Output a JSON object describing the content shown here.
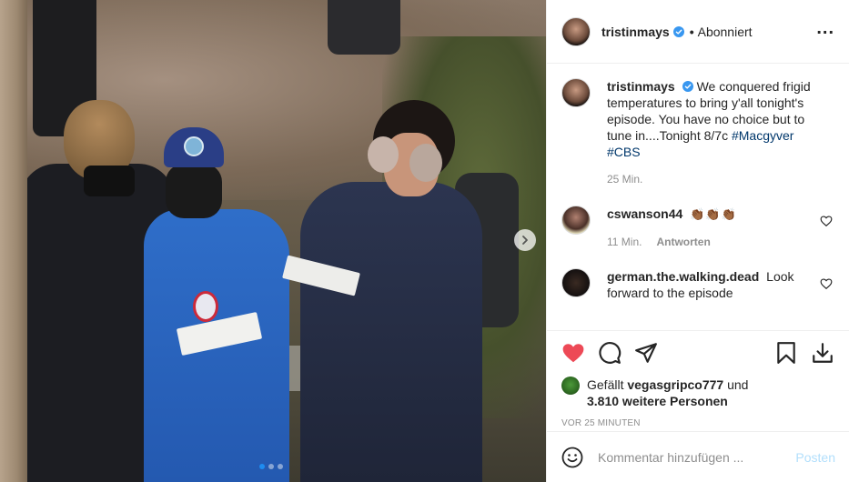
{
  "author": {
    "username": "tristinmays",
    "follow_state": "Abonniert",
    "separator": "•"
  },
  "caption": {
    "username": "tristinmays",
    "text": "We conquered frigid temperatures to bring y'all tonight's episode. You have no choice but to tune in....Tonight 8/7c",
    "tags": "#Macgyver #CBS",
    "time": "25 Min."
  },
  "comments": [
    {
      "username": "cswanson44",
      "text": "👏🏾👏🏾👏🏾",
      "time": "11 Min.",
      "reply_label": "Antworten"
    },
    {
      "username": "german.the.walking.dead",
      "text": "Look forward to the episode"
    }
  ],
  "likes": {
    "prefix": "Gefällt",
    "user": "vegasgripco777",
    "joiner": "und",
    "others": "3.810 weitere Personen"
  },
  "timestamp": "VOR 25 MINUTEN",
  "add_comment": {
    "placeholder": "Kommentar hinzufügen ...",
    "post_label": "Posten"
  },
  "carousel": {
    "slides": 3,
    "active": 1
  },
  "colors": {
    "liked_heart": "#ed4956",
    "verified": "#3897f0",
    "post_button": "#b2dffc",
    "hashtag": "#00376b"
  },
  "icons": [
    "verified-icon",
    "more-options-icon",
    "like-heart-icon",
    "comment-icon",
    "share-icon",
    "save-icon",
    "download-icon",
    "emoji-icon",
    "carousel-next-icon",
    "comment-like-icon"
  ]
}
